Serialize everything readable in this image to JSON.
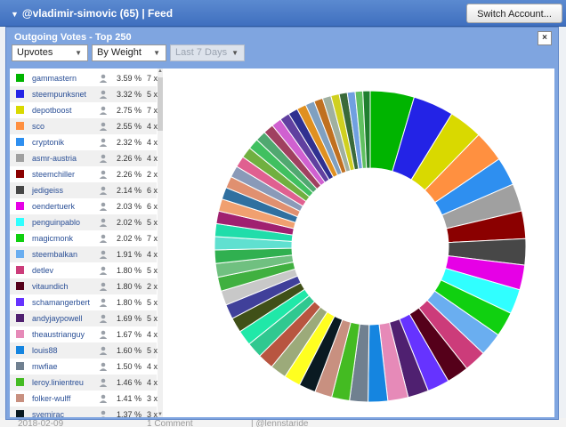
{
  "topbar": {
    "title": "@vladimir-simovic (65)  |  Feed",
    "switch_label": "Switch Account..."
  },
  "background_strip": {
    "date": "2018-02-09",
    "comment": "1 Comment",
    "user": "| @lennstaride"
  },
  "panel": {
    "title": "Outgoing Votes - Top 250",
    "close_label": "×",
    "filters": {
      "type": "Upvotes",
      "sort": "By Weight",
      "period": "Last 7 Days"
    }
  },
  "voters": [
    {
      "name": "gammastern",
      "pct": "3.59 %",
      "count": "7 x",
      "color": "#00b400"
    },
    {
      "name": "steempunksnet",
      "pct": "3.32 %",
      "count": "5 x",
      "color": "#2323e6"
    },
    {
      "name": "depotboost",
      "pct": "2.75 %",
      "count": "7 x",
      "color": "#d9d900"
    },
    {
      "name": "sco",
      "pct": "2.55 %",
      "count": "4 x",
      "color": "#ff9040"
    },
    {
      "name": "cryptonik",
      "pct": "2.32 %",
      "count": "4 x",
      "color": "#2e8ff0"
    },
    {
      "name": "asmr-austria",
      "pct": "2.26 %",
      "count": "4 x",
      "color": "#a0a0a0"
    },
    {
      "name": "steemchiller",
      "pct": "2.26 %",
      "count": "2 x",
      "color": "#8b0000"
    },
    {
      "name": "jedigeiss",
      "pct": "2.14 %",
      "count": "6 x",
      "color": "#474747"
    },
    {
      "name": "oendertuerk",
      "pct": "2.03 %",
      "count": "6 x",
      "color": "#e600e6"
    },
    {
      "name": "penguinpablo",
      "pct": "2.02 %",
      "count": "5 x",
      "color": "#30ffff"
    },
    {
      "name": "magicmonk",
      "pct": "2.02 %",
      "count": "7 x",
      "color": "#10d010"
    },
    {
      "name": "steembalkan",
      "pct": "1.91 %",
      "count": "4 x",
      "color": "#6aaef0"
    },
    {
      "name": "detlev",
      "pct": "1.80 %",
      "count": "5 x",
      "color": "#cc3c7a"
    },
    {
      "name": "vitaundich",
      "pct": "1.80 %",
      "count": "2 x",
      "color": "#55001a"
    },
    {
      "name": "schamangerbert",
      "pct": "1.80 %",
      "count": "5 x",
      "color": "#6633ff"
    },
    {
      "name": "andyjaypowell",
      "pct": "1.69 %",
      "count": "5 x",
      "color": "#4f2070"
    },
    {
      "name": "theaustrianguy",
      "pct": "1.67 %",
      "count": "4 x",
      "color": "#e68ab8"
    },
    {
      "name": "louis88",
      "pct": "1.60 %",
      "count": "5 x",
      "color": "#1585e0"
    },
    {
      "name": "mwfiae",
      "pct": "1.50 %",
      "count": "4 x",
      "color": "#708090"
    },
    {
      "name": "leroy.linientreu",
      "pct": "1.46 %",
      "count": "4 x",
      "color": "#44bb22"
    },
    {
      "name": "folker-wulff",
      "pct": "1.41 %",
      "count": "3 x",
      "color": "#c89080"
    },
    {
      "name": "svemirac",
      "pct": "1.37 %",
      "count": "3 x",
      "color": "#0a1a22"
    }
  ],
  "chart_data": {
    "type": "pie",
    "donut": true,
    "categories": [
      "gammastern",
      "steempunksnet",
      "depotboost",
      "sco",
      "cryptonik",
      "asmr-austria",
      "steemchiller",
      "jedigeiss",
      "oendertuerk",
      "penguinpablo",
      "magicmonk",
      "steembalkan",
      "detlev",
      "vitaundich",
      "schamangerbert",
      "andyjaypowell",
      "theaustrianguy",
      "louis88",
      "mwfiae",
      "leroy.linientreu",
      "folker-wulff",
      "svemirac"
    ],
    "values": [
      3.59,
      3.32,
      2.75,
      2.55,
      2.32,
      2.26,
      2.26,
      2.14,
      2.03,
      2.02,
      2.02,
      1.91,
      1.8,
      1.8,
      1.8,
      1.69,
      1.67,
      1.6,
      1.5,
      1.46,
      1.41,
      1.37
    ],
    "colors": [
      "#00b400",
      "#2323e6",
      "#d9d900",
      "#ff9040",
      "#2e8ff0",
      "#a0a0a0",
      "#8b0000",
      "#474747",
      "#e600e6",
      "#30ffff",
      "#10d010",
      "#6aaef0",
      "#cc3c7a",
      "#55001a",
      "#6633ff",
      "#4f2070",
      "#e68ab8",
      "#1585e0",
      "#708090",
      "#44bb22",
      "#c89080",
      "#0a1a22"
    ],
    "other_values": [
      1.35,
      1.33,
      1.3,
      1.28,
      1.25,
      1.22,
      1.2,
      1.18,
      1.15,
      1.12,
      1.1,
      1.08,
      1.05,
      1.03,
      1.0,
      0.98,
      0.96,
      0.94,
      0.92,
      0.9,
      0.88,
      0.86,
      0.84,
      0.82,
      0.8,
      0.78,
      0.76,
      0.74,
      0.72,
      0.7,
      0.68,
      0.66,
      0.64,
      0.62,
      0.6
    ],
    "other_colors": [
      "#ffff20",
      "#9caa7a",
      "#b85540",
      "#30c890",
      "#20e8a8",
      "#405018",
      "#40409a",
      "#c8c8c8",
      "#40b040",
      "#70c080",
      "#30b050",
      "#60e0d0",
      "#20ddaa",
      "#a02070",
      "#f0a070",
      "#3070a0",
      "#e09070",
      "#8a9ab8",
      "#e06090",
      "#70b040",
      "#40c060",
      "#50a870",
      "#a04060",
      "#d060d0",
      "#6040a0",
      "#303090",
      "#e09020",
      "#80a0c0",
      "#c07020",
      "#a0b0a0",
      "#d0d020",
      "#3a6a3a",
      "#70a0e0",
      "#60c060",
      "#208030"
    ]
  }
}
